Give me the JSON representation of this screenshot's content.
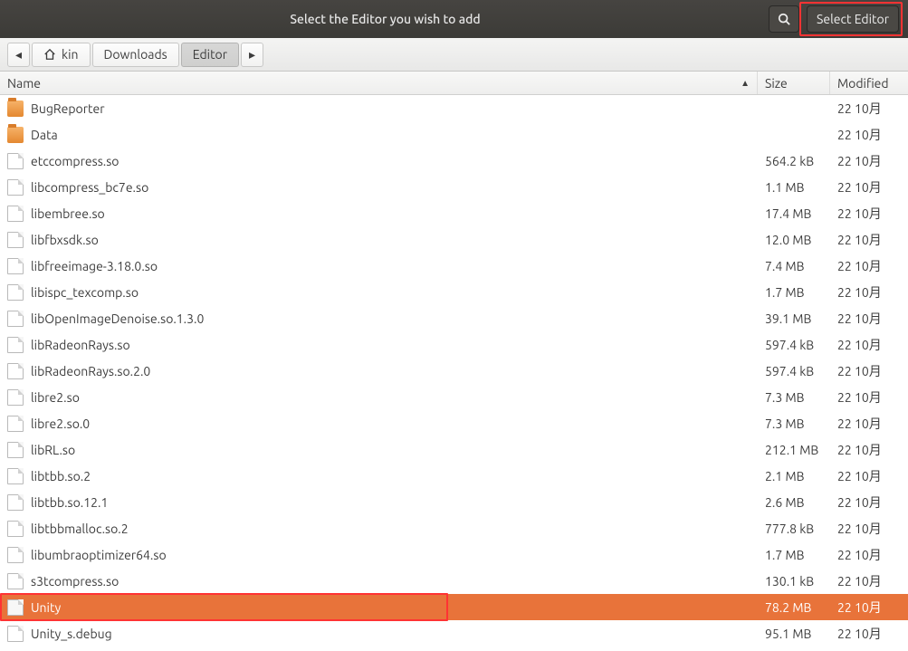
{
  "titlebar": {
    "title": "Select the Editor you wish to add",
    "select_label": "Select Editor"
  },
  "breadcrumbs": {
    "back_icon": "◂",
    "home_icon": "⌂",
    "home_label": "kin",
    "crumbs": [
      "Downloads",
      "Editor"
    ],
    "fwd_icon": "▸"
  },
  "columns": {
    "name": "Name",
    "size": "Size",
    "modified": "Modified",
    "sort_indicator": "▲"
  },
  "files": [
    {
      "name": "BugReporter",
      "size": "",
      "modified": "22 10月",
      "type": "folder",
      "selected": false
    },
    {
      "name": "Data",
      "size": "",
      "modified": "22 10月",
      "type": "folder",
      "selected": false
    },
    {
      "name": "etccompress.so",
      "size": "564.2 kB",
      "modified": "22 10月",
      "type": "file",
      "selected": false
    },
    {
      "name": "libcompress_bc7e.so",
      "size": "1.1 MB",
      "modified": "22 10月",
      "type": "file",
      "selected": false
    },
    {
      "name": "libembree.so",
      "size": "17.4 MB",
      "modified": "22 10月",
      "type": "file",
      "selected": false
    },
    {
      "name": "libfbxsdk.so",
      "size": "12.0 MB",
      "modified": "22 10月",
      "type": "file",
      "selected": false
    },
    {
      "name": "libfreeimage-3.18.0.so",
      "size": "7.4 MB",
      "modified": "22 10月",
      "type": "file",
      "selected": false
    },
    {
      "name": "libispc_texcomp.so",
      "size": "1.7 MB",
      "modified": "22 10月",
      "type": "file",
      "selected": false
    },
    {
      "name": "libOpenImageDenoise.so.1.3.0",
      "size": "39.1 MB",
      "modified": "22 10月",
      "type": "file",
      "selected": false
    },
    {
      "name": "libRadeonRays.so",
      "size": "597.4 kB",
      "modified": "22 10月",
      "type": "file",
      "selected": false
    },
    {
      "name": "libRadeonRays.so.2.0",
      "size": "597.4 kB",
      "modified": "22 10月",
      "type": "file",
      "selected": false
    },
    {
      "name": "libre2.so",
      "size": "7.3 MB",
      "modified": "22 10月",
      "type": "file",
      "selected": false
    },
    {
      "name": "libre2.so.0",
      "size": "7.3 MB",
      "modified": "22 10月",
      "type": "file",
      "selected": false
    },
    {
      "name": "libRL.so",
      "size": "212.1 MB",
      "modified": "22 10月",
      "type": "file",
      "selected": false
    },
    {
      "name": "libtbb.so.2",
      "size": "2.1 MB",
      "modified": "22 10月",
      "type": "file",
      "selected": false
    },
    {
      "name": "libtbb.so.12.1",
      "size": "2.6 MB",
      "modified": "22 10月",
      "type": "file",
      "selected": false
    },
    {
      "name": "libtbbmalloc.so.2",
      "size": "777.8 kB",
      "modified": "22 10月",
      "type": "file",
      "selected": false
    },
    {
      "name": "libumbraoptimizer64.so",
      "size": "1.7 MB",
      "modified": "22 10月",
      "type": "file",
      "selected": false
    },
    {
      "name": "s3tcompress.so",
      "size": "130.1 kB",
      "modified": "22 10月",
      "type": "file",
      "selected": false
    },
    {
      "name": "Unity",
      "size": "78.2 MB",
      "modified": "22 10月",
      "type": "exec",
      "selected": true,
      "highlighted": true
    },
    {
      "name": "Unity_s.debug",
      "size": "95.1 MB",
      "modified": "22 10月",
      "type": "file",
      "selected": false
    }
  ]
}
